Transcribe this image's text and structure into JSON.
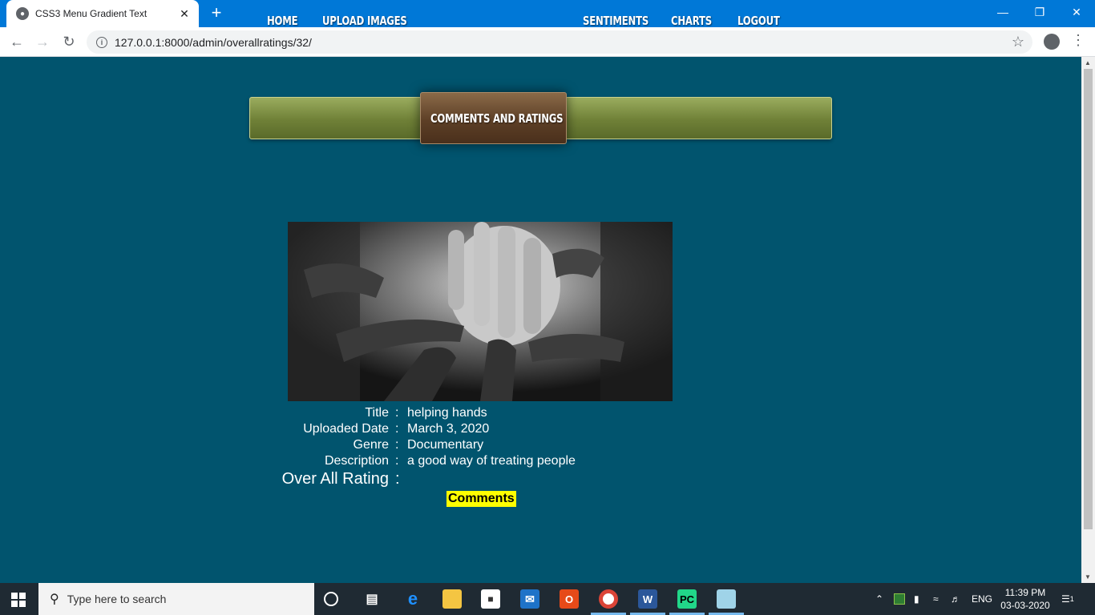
{
  "browser": {
    "tab_title": "CSS3 Menu Gradient Text",
    "url": "127.0.0.1:8000/admin/overallratings/32/"
  },
  "nav": {
    "items": [
      "HOME",
      "UPLOAD IMAGES",
      "COMMENTS AND RATINGS",
      "SENTIMENTS",
      "CHARTS",
      "LOGOUT"
    ],
    "active": "COMMENTS AND RATINGS"
  },
  "details": {
    "title_label": "Title",
    "title_value": "helping hands",
    "date_label": "Uploaded Date",
    "date_value": "March 3, 2020",
    "genre_label": "Genre",
    "genre_value": "Documentary",
    "description_label": "Description",
    "description_value": "a good way of treating people",
    "rating_label": "Over All Rating",
    "separator": ":",
    "comments_label": "Comments"
  },
  "taskbar": {
    "search_placeholder": "Type here to search",
    "language": "ENG",
    "time": "11:39 PM",
    "date": "03-03-2020",
    "notification_count": "1"
  },
  "colors": {
    "page_bg": "#01546e",
    "menu_green": "#7a8c3d",
    "menu_active_brown": "#5d3f26",
    "comments_highlight": "#ffff00",
    "chrome_blue": "#0078d7"
  }
}
